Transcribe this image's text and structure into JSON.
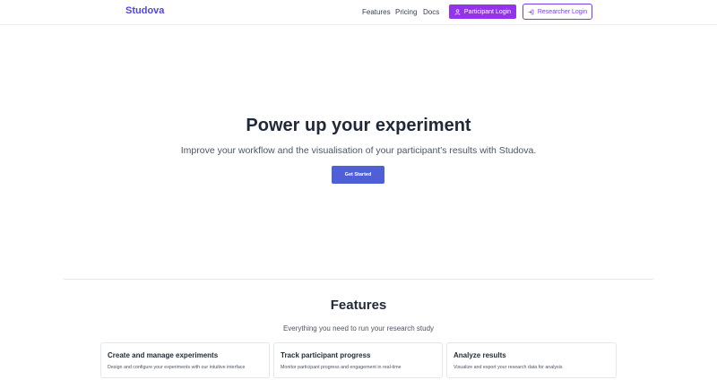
{
  "nav": {
    "brand": "Studova",
    "links": [
      "Features",
      "Pricing",
      "Docs"
    ],
    "participant_login": "Participant Login",
    "researcher_login": "Researcher Login",
    "icons": {
      "participant": "user-icon",
      "researcher": "login-icon"
    },
    "colors": {
      "brand": "#4f46e5",
      "participant_button": "#9333ea",
      "researcher_border": "#7c3aed"
    }
  },
  "hero": {
    "title": "Power up your experiment",
    "subtitle": "Improve your workflow and the visualisation of your participant's results with Studova.",
    "cta": "Get Started",
    "cta_color": "#4f5fd6"
  },
  "features": {
    "title": "Features",
    "subtitle": "Everything you need to run your research study",
    "cards": [
      {
        "title": "Create and manage experiments",
        "description": "Design and configure your experiments with our intuitive interface"
      },
      {
        "title": "Track participant progress",
        "description": "Monitor participant progress and engagement in real-time"
      },
      {
        "title": "Analyze results",
        "description": "Visualize and export your research data for analysis"
      }
    ]
  }
}
